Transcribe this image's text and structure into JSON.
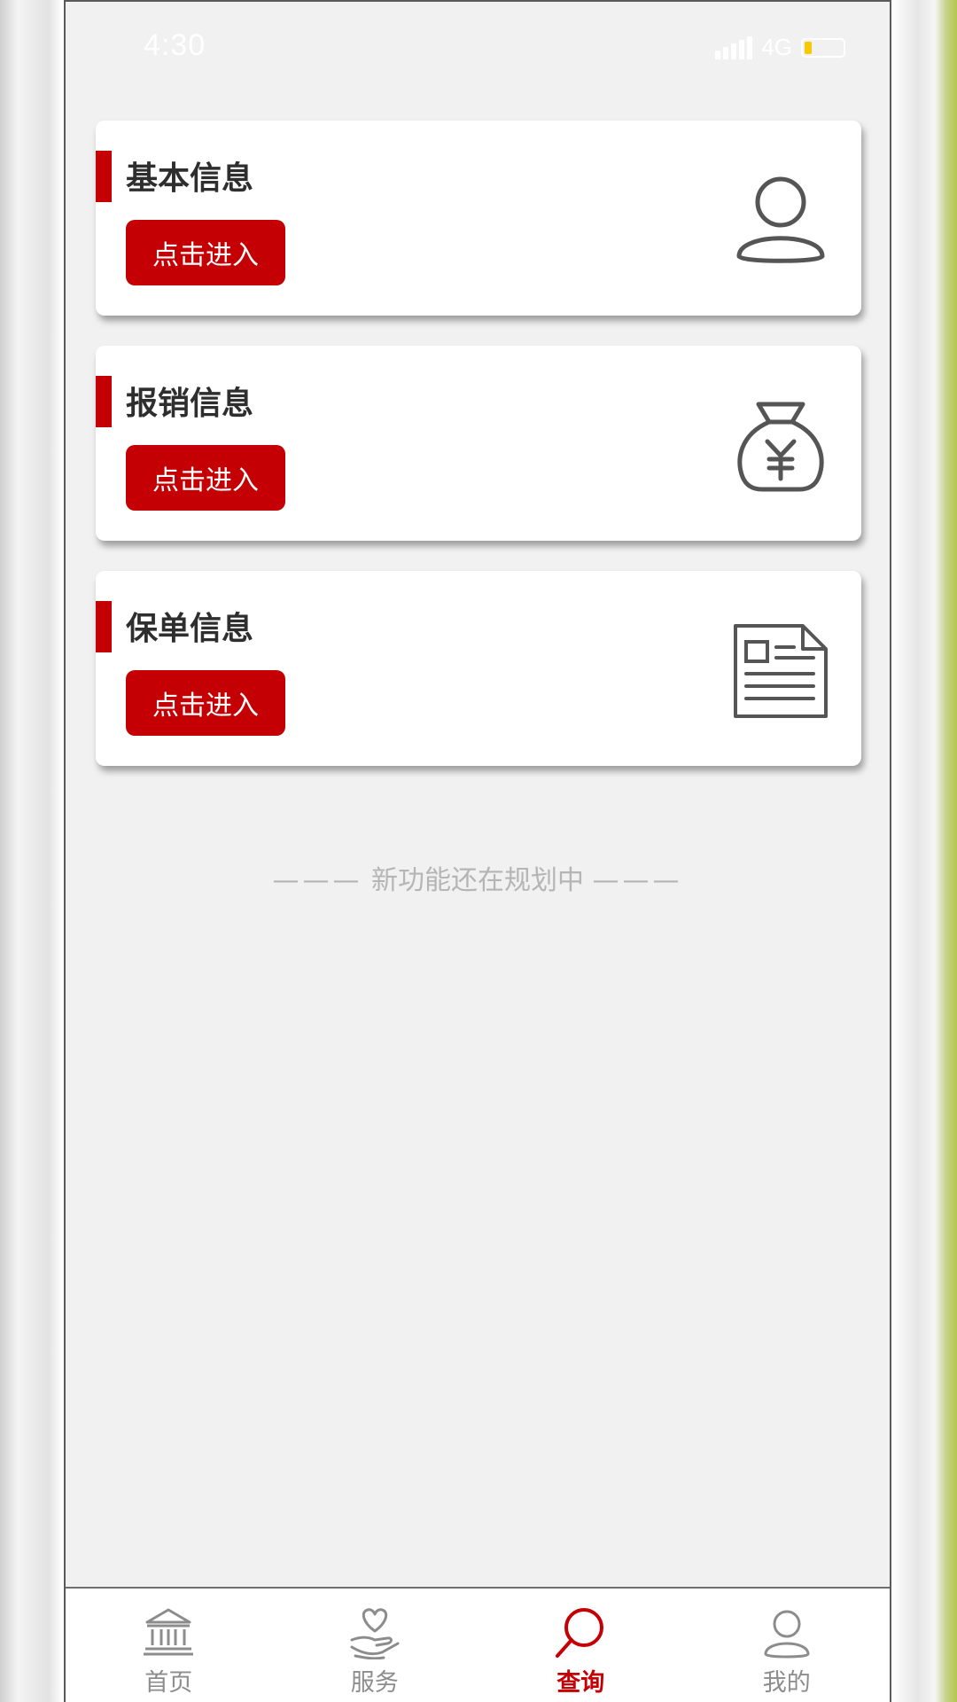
{
  "status_bar": {
    "time": "4:30",
    "network": "4G"
  },
  "cards": [
    {
      "title": "基本信息",
      "button_label": "点击进入",
      "icon": "person-icon"
    },
    {
      "title": "报销信息",
      "button_label": "点击进入",
      "icon": "money-bag-icon"
    },
    {
      "title": "保单信息",
      "button_label": "点击进入",
      "icon": "document-icon"
    }
  ],
  "footer_note": {
    "dashes": "———",
    "text": "新功能还在规划中"
  },
  "tabbar": {
    "active": "查询",
    "accent_color": "#c40005",
    "items": [
      {
        "label": "首页",
        "icon": "bank-icon"
      },
      {
        "label": "服务",
        "icon": "heart-hand-icon"
      },
      {
        "label": "查询",
        "icon": "search-icon"
      },
      {
        "label": "我的",
        "icon": "user-icon"
      }
    ]
  },
  "colors": {
    "brand_red": "#c40005",
    "background": "#f1f1f1",
    "battery": "#f7c900"
  }
}
